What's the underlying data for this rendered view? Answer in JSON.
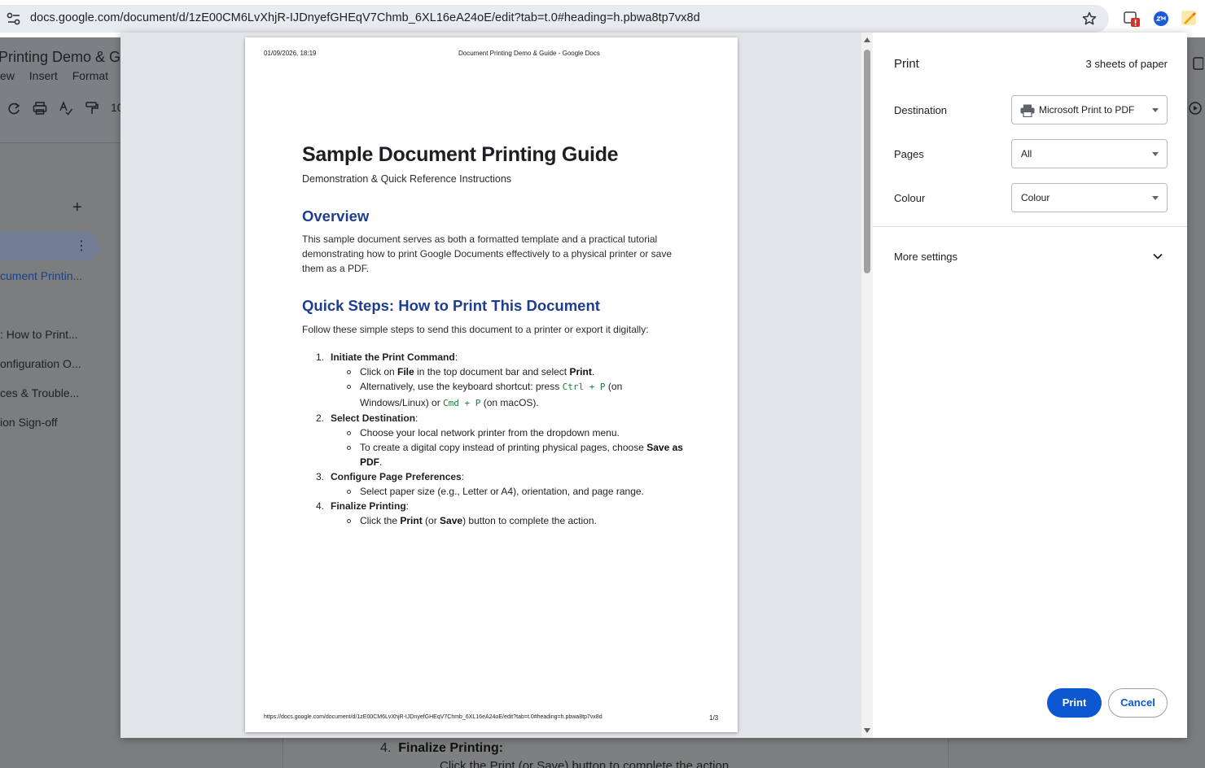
{
  "browser": {
    "url": "docs.google.com/document/d/1zE00CM6LvXhjR-IJDnyefGHEqV7Chmb_6XL16eA24oE/edit?tab=t.0#heading=h.pbwa8tp7vx8d"
  },
  "docs_background": {
    "title": "Printing Demo & Gu",
    "menu": [
      "ew",
      "Insert",
      "Format"
    ],
    "zoom_partial": "10",
    "outline": [
      "cument Printin...",
      ": How to Print...",
      "onfiguration O...",
      "ces & Trouble...",
      "ion Sign-off"
    ],
    "under_page_heading_num": "4.",
    "under_page_heading": "Finalize Printing:",
    "under_page_line": "Click the Print (or Save) button to complete the action."
  },
  "preview": {
    "header_date": "01/09/2026, 18:19",
    "header_title": "Document Printing Demo & Guide - Google Docs",
    "footer_url": "https://docs.google.com/document/d/1zE00CM6LvXhjR-IJDnyefGHEqV7Chmb_6XL16eA24oE/edit?tab=t.0#heading=h.pbwa8tp7vx8d",
    "footer_page": "1/3",
    "doc_title": "Sample Document Printing Guide",
    "doc_subtitle": "Demonstration & Quick Reference Instructions",
    "overview_heading": "Overview",
    "overview_text": "This sample document serves as both a formatted template and a practical tutorial demonstrating how to print Google Documents effectively to a physical printer or save them as a PDF.",
    "quick_heading": "Quick Steps: How to Print This Document",
    "quick_intro": "Follow these simple steps to send this document to a printer or export it digitally:",
    "steps": [
      {
        "num": "1.",
        "title": "Initiate the Print Command"
      },
      {
        "num": "2.",
        "title": "Select Destination"
      },
      {
        "num": "3.",
        "title": "Configure Page Preferences"
      },
      {
        "num": "4.",
        "title": "Finalize Printing"
      }
    ],
    "s1a_pre": "Click on ",
    "s1a_b1": "File",
    "s1a_mid": " in the top document bar and select ",
    "s1a_b2": "Print",
    "s1a_end": ".",
    "s1b_pre": "Alternatively, use the keyboard shortcut: press ",
    "s1b_code1": "Ctrl + P",
    "s1b_mid": " (on Windows/Linux) or ",
    "s1b_code2": "Cmd + P",
    "s1b_end": " (on macOS).",
    "s2a": "Choose your local network printer from the dropdown menu.",
    "s2b_pre": "To create a digital copy instead of printing physical pages, choose ",
    "s2b_b": "Save as PDF",
    "s2b_end": ".",
    "s3a": "Select paper size (e.g., Letter or A4), orientation, and page range.",
    "s4a_pre": "Click the ",
    "s4a_b1": "Print",
    "s4a_mid": " (or ",
    "s4a_b2": "Save",
    "s4a_end": ") button to complete the action."
  },
  "settings": {
    "title": "Print",
    "sheets": "3 sheets of paper",
    "destination_label": "Destination",
    "destination_value": "Microsoft Print to PDF",
    "pages_label": "Pages",
    "pages_value": "All",
    "colour_label": "Colour",
    "colour_value": "Colour",
    "more_settings": "More settings",
    "print_button": "Print",
    "cancel_button": "Cancel"
  },
  "colors": {
    "primary_button": "#0b57d0",
    "heading_blue": "#1f3d8e",
    "code_green": "#188038"
  }
}
